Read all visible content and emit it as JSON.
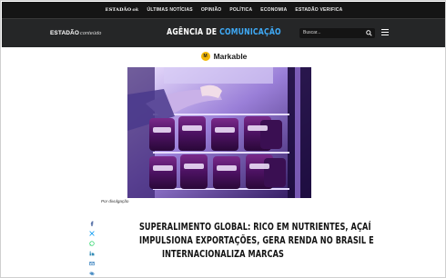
{
  "topbar": {
    "brand": "ESTADÃO",
    "brand_suffix": "ok",
    "nav": [
      "ÚLTIMAS NOTÍCIAS",
      "OPINIÃO",
      "POLÍTICA",
      "ECONOMIA",
      "ESTADÃO VERIFICA"
    ]
  },
  "header": {
    "logo": "ESTADÃO",
    "logo_suffix": "conteúdo",
    "title_part1": "AGÊNCIA DE ",
    "title_part2": "COMUNICAÇÃO",
    "search_placeholder": "Buscar...",
    "accent_color": "#3fa9f5"
  },
  "sponsor": {
    "badge": "M",
    "name": "Markable"
  },
  "photo": {
    "caption": "Por divulgação"
  },
  "share_icons": [
    "facebook-icon",
    "x-twitter-icon",
    "whatsapp-icon",
    "linkedin-icon",
    "email-icon",
    "copy-link-icon"
  ],
  "article": {
    "headline_lines": [
      "SUPERALIMENTO GLOBAL: RICO EM NUTRIENTES, AÇAÍ",
      "IMPULSIONA EXPORTAÇÕES, GERA RENDA NO BRASIL E",
      "INTERNACIONALIZA MARCAS"
    ]
  }
}
